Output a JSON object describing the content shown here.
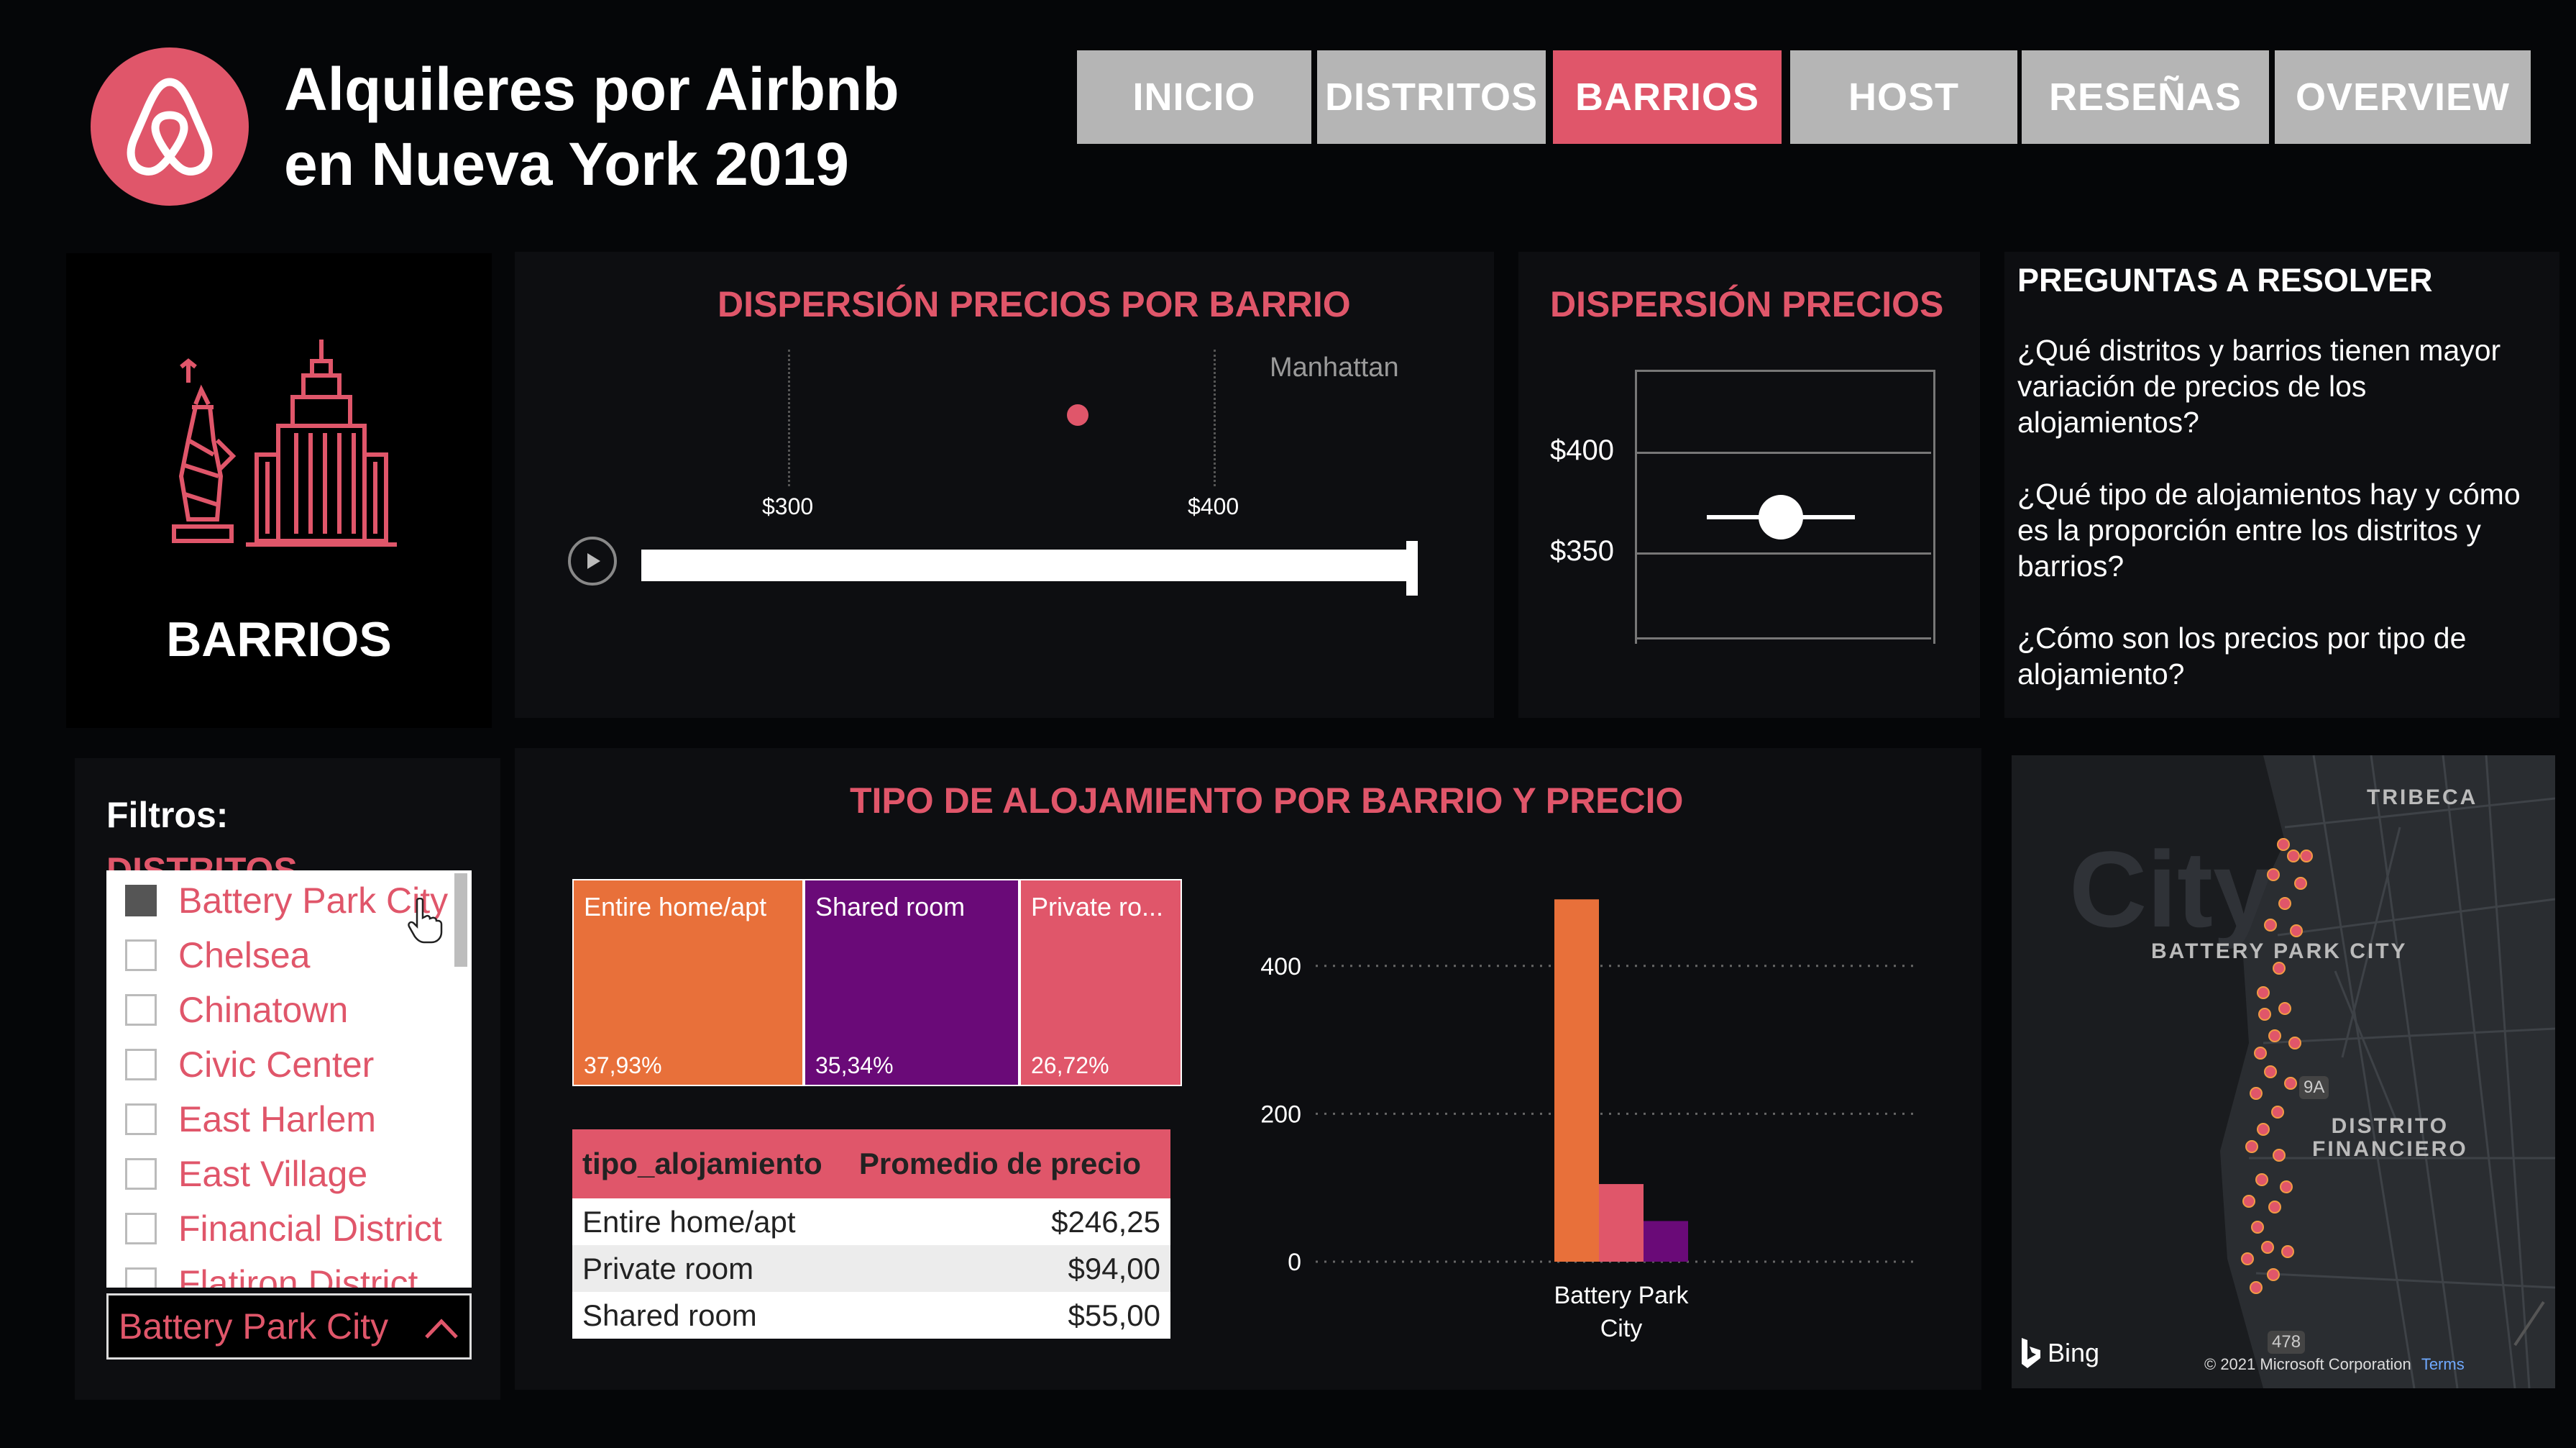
{
  "app": {
    "title_line1": "Alquileres por Airbnb",
    "title_line2": "en Nueva York 2019",
    "brand_color": "#e0566a"
  },
  "nav": [
    {
      "label": "INICIO",
      "active": false
    },
    {
      "label": "DISTRITOS",
      "active": false
    },
    {
      "label": "BARRIOS",
      "active": true
    },
    {
      "label": "HOST",
      "active": false
    },
    {
      "label": "RESEÑAS",
      "active": false
    },
    {
      "label": "OVERVIEW",
      "active": false
    }
  ],
  "section": {
    "label": "BARRIOS",
    "icon": "new-york-skyline-icon"
  },
  "scatter_panel": {
    "title": "DISPERSIÓN PRECIOS POR BARRIO",
    "district_label": "Manhattan",
    "tick_300": "$300",
    "tick_400": "$400",
    "play_slider_position": 1.0
  },
  "box_panel": {
    "title": "DISPERSIÓN PRECIOS",
    "tick_400": "$400",
    "tick_350": "$350"
  },
  "questions": {
    "title": "PREGUNTAS A RESOLVER",
    "q1": "¿Qué distritos y barrios tienen mayor variación de precios de los alojamientos?",
    "q2": "¿Qué tipo de alojamientos hay y cómo es la proporción entre los distritos y barrios?",
    "q3": "¿Cómo son los precios por tipo de alojamiento?"
  },
  "filters": {
    "title": "Filtros:",
    "subtitle": "DISTRITOS",
    "items": [
      {
        "label": "Battery Park City",
        "checked": true
      },
      {
        "label": "Chelsea",
        "checked": false
      },
      {
        "label": "Chinatown",
        "checked": false
      },
      {
        "label": "Civic Center",
        "checked": false
      },
      {
        "label": "East Harlem",
        "checked": false
      },
      {
        "label": "East Village",
        "checked": false
      },
      {
        "label": "Financial District",
        "checked": false
      },
      {
        "label": "Flatiron District",
        "checked": false
      }
    ],
    "selected": "Battery Park City"
  },
  "main_panel": {
    "title": "TIPO DE ALOJAMIENTO POR BARRIO Y PRECIO"
  },
  "treemap": [
    {
      "label": "Entire home/apt",
      "pct": "37,93%",
      "color": "#e8703a"
    },
    {
      "label": "Shared room",
      "pct": "35,34%",
      "color": "#6a0a78"
    },
    {
      "label": "Private ro...",
      "pct": "26,72%",
      "color": "#e0566a"
    }
  ],
  "table": {
    "headers": [
      "tipo_alojamiento",
      "Promedio de precio"
    ],
    "rows": [
      [
        "Entire home/apt",
        "$246,25"
      ],
      [
        "Private room",
        "$94,00"
      ],
      [
        "Shared room",
        "$55,00"
      ]
    ]
  },
  "chart_data": {
    "type": "bar",
    "categories": [
      "Battery Park City"
    ],
    "category_label_line1": "Battery Park",
    "category_label_line2": "City",
    "series": [
      {
        "values": [
          490
        ],
        "color": "#e8703a"
      },
      {
        "values": [
          105
        ],
        "color": "#e0566a"
      },
      {
        "values": [
          55
        ],
        "color": "#6a0a78"
      }
    ],
    "ylim": [
      0,
      500
    ],
    "yticks": [
      0,
      200,
      400
    ],
    "grid": true
  },
  "map": {
    "label_tribeca": "TRIBECA",
    "label_battery": "BATTERY PARK CITY",
    "label_distrito1": "DISTRITO",
    "label_distrito2": "FINANCIERO",
    "label_city": "City",
    "bing": "Bing",
    "copyright": "© 2021 Microsoft Corporation",
    "terms": "Terms",
    "route_badge": "478",
    "route_badge2": "9A"
  }
}
